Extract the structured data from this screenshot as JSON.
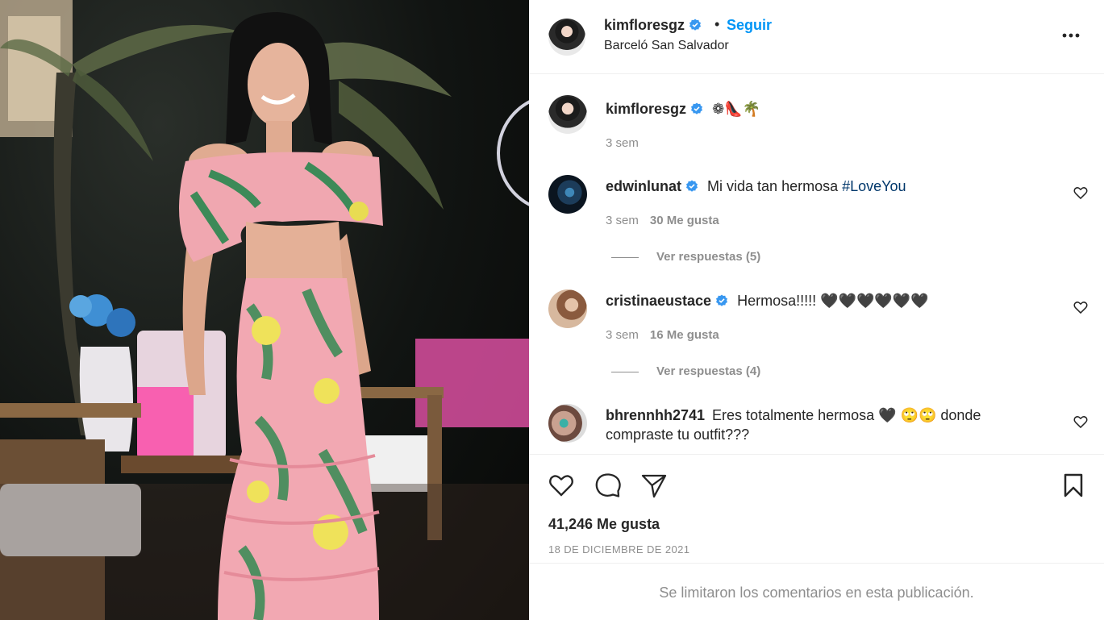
{
  "post": {
    "owner": "kimfloresgz",
    "follow_label": "Seguir",
    "location": "Barceló San Salvador",
    "caption": "❁👠🌴",
    "caption_time": "3 sem",
    "likes": "41,246 Me gusta",
    "date": "18 DE DICIEMBRE DE 2021",
    "comments_limited": "Se limitaron los comentarios en esta publicación."
  },
  "comments": [
    {
      "user": "edwinlunat",
      "text": "Mi vida tan hermosa ",
      "hashtag": "#LoveYou",
      "time": "3 sem",
      "likes": "30 Me gusta",
      "replies": "Ver respuestas (5)"
    },
    {
      "user": "cristinaeustace",
      "text": "Hermosa!!!!! 🖤🖤🖤🖤🖤🖤",
      "time": "3 sem",
      "likes": "16 Me gusta",
      "replies": "Ver respuestas (4)"
    },
    {
      "user": "bhrennhh2741",
      "text": "Eres totalmente hermosa 🖤 🙄🙄 donde",
      "text2": "compraste tu outfit???"
    }
  ],
  "colors": {
    "link": "#0095f6",
    "hashtag": "#00376b",
    "muted": "#8e8e8e",
    "verified": "#3897f0"
  },
  "icons": [
    "verified-badge-icon",
    "more-options-icon",
    "heart-icon",
    "comment-icon",
    "share-icon",
    "bookmark-icon"
  ]
}
